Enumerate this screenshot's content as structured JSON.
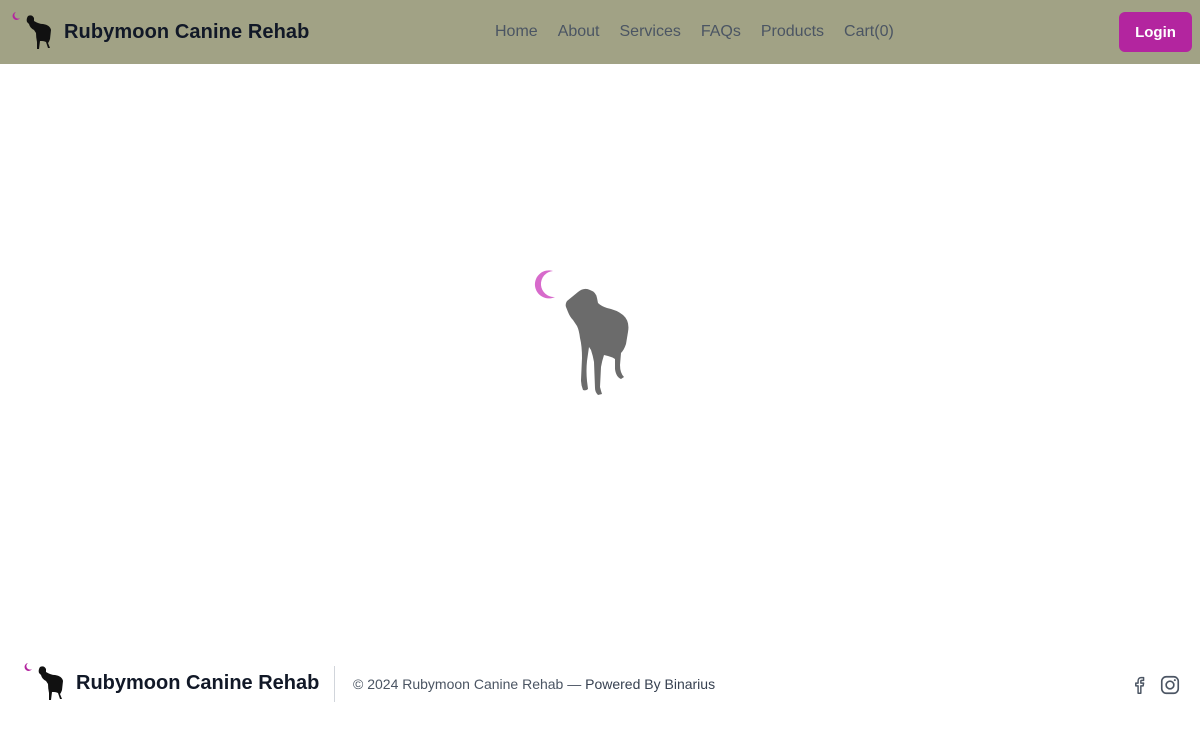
{
  "brand": {
    "name": "Rubymoon Canine Rehab"
  },
  "nav": {
    "items": [
      {
        "label": "Home"
      },
      {
        "label": "About"
      },
      {
        "label": "Services"
      },
      {
        "label": "FAQs"
      },
      {
        "label": "Products"
      },
      {
        "label": "Cart(0)"
      }
    ]
  },
  "header": {
    "login_label": "Login"
  },
  "footer": {
    "brand_name": "Rubymoon Canine Rehab",
    "copyright": "© 2024 Rubymoon Canine Rehab — ",
    "powered_by": "Powered By Binarius",
    "social": [
      "facebook-icon",
      "instagram-icon"
    ]
  },
  "colors": {
    "header_bg": "#a1a285",
    "accent": "#b3259f",
    "moon": "#d76acb",
    "loader_dog": "#6b6b6b",
    "logo_dog": "#111111"
  }
}
